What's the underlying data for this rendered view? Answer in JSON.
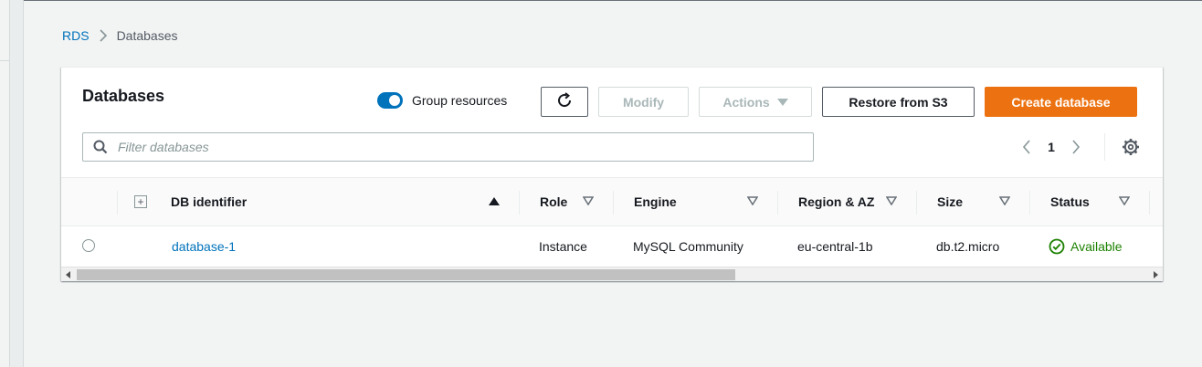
{
  "breadcrumb": {
    "root": "RDS",
    "current": "Databases"
  },
  "panel": {
    "title": "Databases",
    "group_toggle": {
      "label": "Group resources",
      "on": true
    },
    "buttons": {
      "refresh_icon": "refresh-icon",
      "modify": "Modify",
      "actions": "Actions",
      "restore": "Restore from S3",
      "create": "Create database"
    },
    "filter": {
      "placeholder": "Filter databases",
      "value": ""
    },
    "pagination": {
      "page": "1"
    }
  },
  "table": {
    "columns": [
      "DB identifier",
      "Role",
      "Engine",
      "Region & AZ",
      "Size",
      "Status"
    ],
    "rows": [
      {
        "identifier": "database-1",
        "role": "Instance",
        "engine": "MySQL Community",
        "region": "eu-central-1b",
        "size": "db.t2.micro",
        "status": "Available"
      }
    ]
  },
  "colors": {
    "link": "#0073bb",
    "primary": "#ec7211",
    "success": "#1d8102",
    "toggle_on": "#0073bb"
  }
}
